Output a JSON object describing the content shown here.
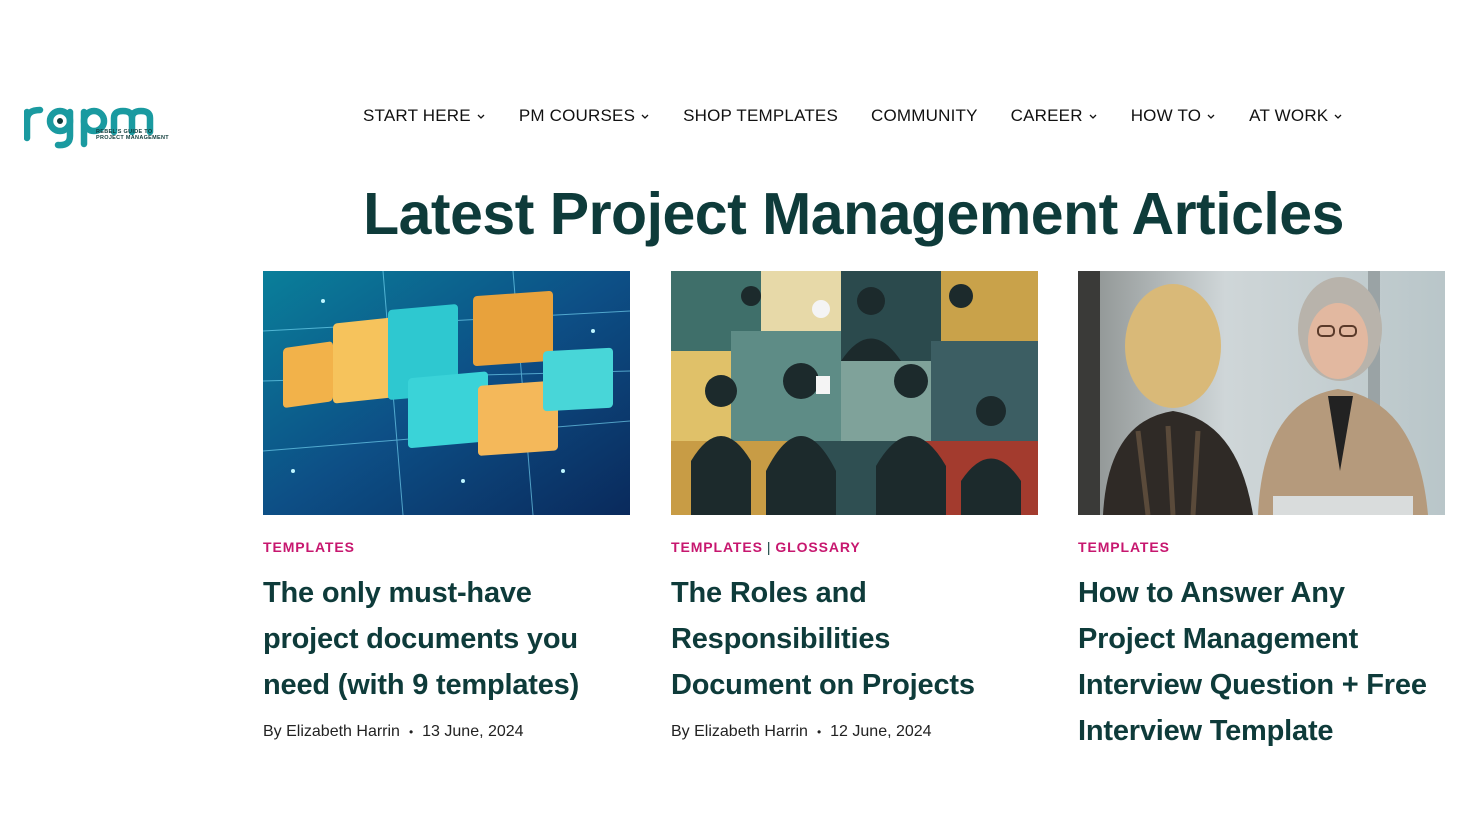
{
  "logo": {
    "wordmark": "rgpm",
    "tagline": "Rebel's Guide to Project Management"
  },
  "nav": [
    {
      "label": "START HERE",
      "dropdown": true
    },
    {
      "label": "PM COURSES",
      "dropdown": true
    },
    {
      "label": "SHOP TEMPLATES",
      "dropdown": false
    },
    {
      "label": "COMMUNITY",
      "dropdown": false
    },
    {
      "label": "CAREER",
      "dropdown": true
    },
    {
      "label": "HOW TO",
      "dropdown": true
    },
    {
      "label": "AT WORK",
      "dropdown": true
    }
  ],
  "page_title": "Latest Project Management Articles",
  "articles": [
    {
      "categories": [
        "TEMPLATES"
      ],
      "title": "The only must-have project documents you need (with 9 templates)",
      "by": "By",
      "author": "Elizabeth Harrin",
      "date": "13 June, 2024",
      "image": "folders-illustration"
    },
    {
      "categories": [
        "TEMPLATES",
        "GLOSSARY"
      ],
      "category_separator": "|",
      "title": "The Roles and Responsibilities Document on Projects",
      "by": "By",
      "author": "Elizabeth Harrin",
      "date": "12 June, 2024",
      "image": "team-silhouettes-collage"
    },
    {
      "categories": [
        "TEMPLATES"
      ],
      "title": "How to Answer Any Project Management Interview Question + Free Interview Template",
      "by": "",
      "author": "",
      "date": "",
      "image": "interview-photo"
    }
  ],
  "colors": {
    "brand_teal": "#1a9aa0",
    "heading": "#0e3b3a",
    "category": "#c7176f",
    "nav_text": "#111111"
  },
  "meta_separator": "•"
}
